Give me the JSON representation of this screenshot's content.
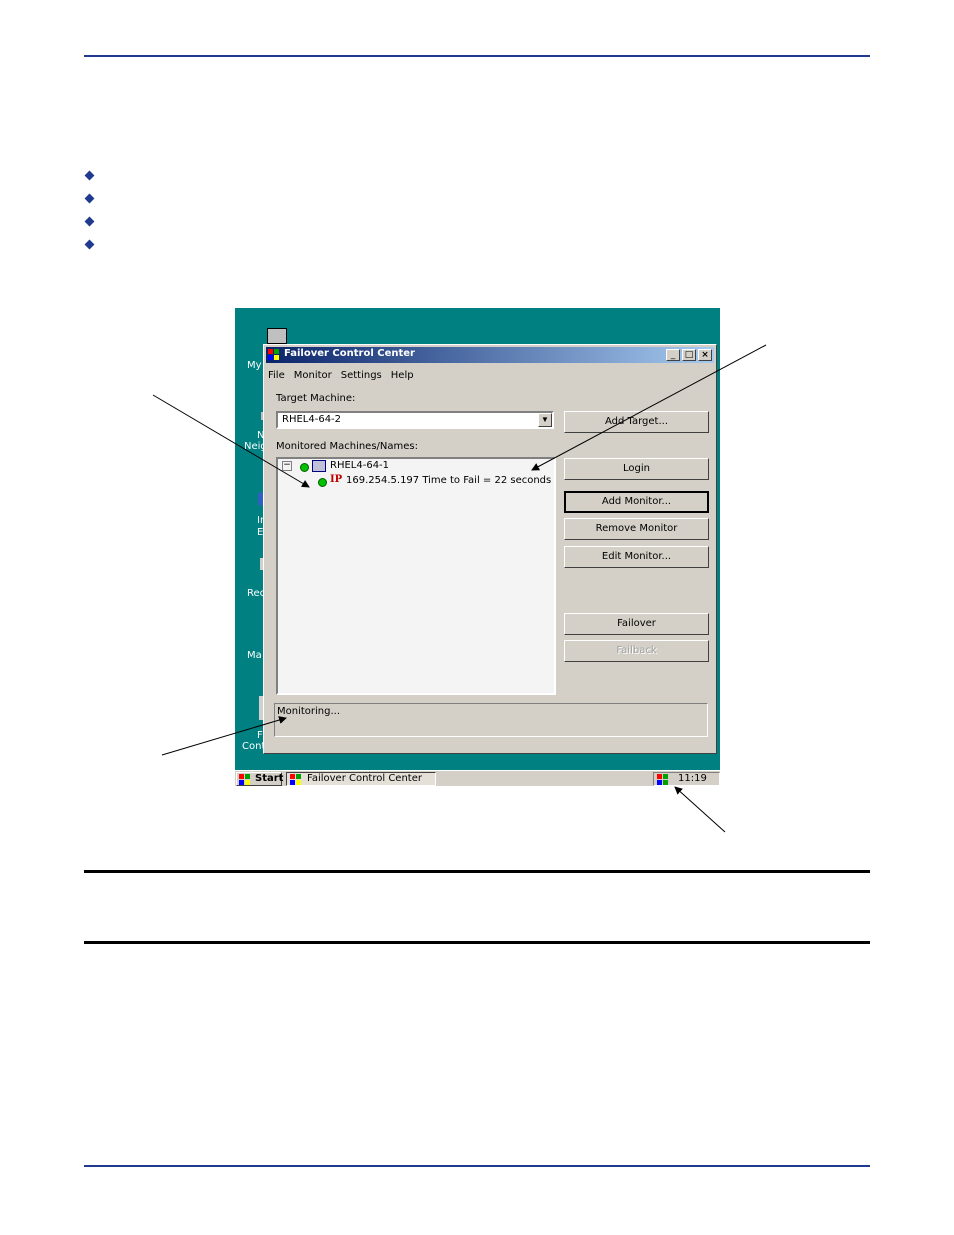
{
  "desktop": {
    "labels": [
      "My",
      "N",
      "Neig",
      "In",
      "E",
      "Rec",
      "Ma",
      "F",
      "Control Center"
    ]
  },
  "window": {
    "title": "Failover Control Center",
    "menu": [
      "File",
      "Monitor",
      "Settings",
      "Help"
    ],
    "target_label": "Target Machine:",
    "target_value": "RHEL4-64-2",
    "monitored_label": "Monitored Machines/Names:",
    "tree": {
      "machine": "RHEL4-64-1",
      "monitor_icon": "IP",
      "monitor_text": "169.254.5.197  Time to Fail = 22 seconds"
    },
    "buttons": {
      "add_target": "Add Target...",
      "login": "Login",
      "add_monitor": "Add Monitor...",
      "remove_monitor": "Remove Monitor",
      "edit_monitor": "Edit Monitor...",
      "failover": "Failover",
      "failback": "Failback"
    },
    "status": "Monitoring..."
  },
  "taskbar": {
    "start": "Start",
    "task": "Failover Control Center",
    "clock": "11:19 AM"
  },
  "colors": {
    "rule_blue": "#1f3a8f",
    "desktop_teal": "#008080",
    "titlebar": "#0a246a",
    "status_green": "#00c000"
  }
}
